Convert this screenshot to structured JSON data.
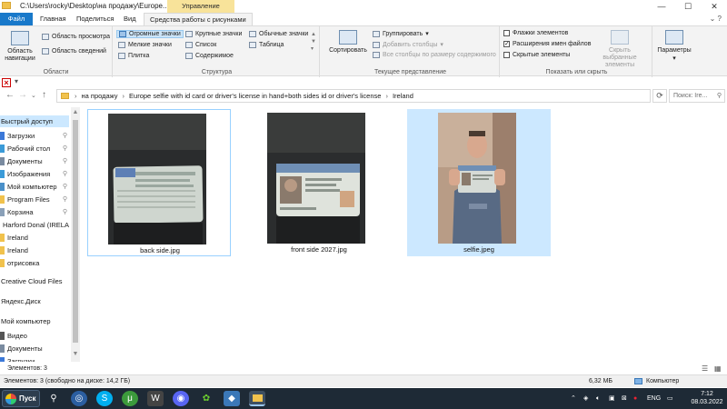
{
  "window": {
    "title": "C:\\Users\\rocky\\Desktop\\на продажу\\Europe...",
    "context_tab": "Управление",
    "controls": {
      "minimize": "—",
      "maximize": "☐",
      "close": "✕"
    }
  },
  "tabs": [
    "Файл",
    "Главная",
    "Поделиться",
    "Вид",
    "Средства работы с рисунками"
  ],
  "ribbon": {
    "panels": {
      "nav_pane": "Область навигации",
      "preview": "Область просмотра",
      "details": "Область сведений",
      "label": "Области"
    },
    "layout": {
      "items": [
        "Огромные значки",
        "Крупные значки",
        "Обычные значки",
        "Мелкие значки",
        "Список",
        "Таблица",
        "Плитка",
        "Содержимое"
      ],
      "label": "Структура"
    },
    "current_view": {
      "sort": "Сортировать",
      "group": "Группировать",
      "add_columns": "Добавить столбцы",
      "fit_columns": "Все столбцы по размеру содержимого",
      "label": "Текущее представление"
    },
    "show_hide": {
      "item_checkboxes": "Флажки элементов",
      "file_extensions": "Расширения имен файлов",
      "hidden_items": "Скрытые элементы",
      "hide_selected": "Скрыть выбранные элементы",
      "label": "Показать или скрыть"
    },
    "options": "Параметры"
  },
  "address": {
    "crumbs": [
      "на продажу",
      "Europe selfie with id card or driver's license in hand+both sides id or driver's license",
      "Ireland"
    ],
    "search_placeholder": "Поиск: Ire..."
  },
  "nav": [
    {
      "label": "Быстрый доступ",
      "head": true,
      "selected": true,
      "color": ""
    },
    {
      "label": "Загрузки",
      "pin": true,
      "color": "#3b78d8"
    },
    {
      "label": "Рабочий стол",
      "pin": true,
      "color": "#3b9bd8"
    },
    {
      "label": "Документы",
      "pin": true,
      "color": "#7a8ba0"
    },
    {
      "label": "Изображения",
      "pin": true,
      "color": "#3b9bd8"
    },
    {
      "label": "Мой компьютер",
      "pin": true,
      "color": "#4a90c9"
    },
    {
      "label": "Program Files",
      "pin": true,
      "color": "#f1c24d"
    },
    {
      "label": "Корзина",
      "pin": true,
      "color": "#8aa0b8"
    },
    {
      "label": "Harford Donal (IRELAN",
      "color": "#f1c24d"
    },
    {
      "label": "Ireland",
      "color": "#f1c24d"
    },
    {
      "label": "Ireland",
      "color": "#f1c24d"
    },
    {
      "label": "отрисовка",
      "color": "#f1c24d"
    },
    {
      "label": "Creative Cloud Files",
      "head": true,
      "color": ""
    },
    {
      "label": "Яндекс.Диск",
      "head": true,
      "color": ""
    },
    {
      "label": "Мой компьютер",
      "head": true,
      "color": ""
    },
    {
      "label": "Видео",
      "color": "#555"
    },
    {
      "label": "Документы",
      "color": "#7a8ba0"
    },
    {
      "label": "Загрузки",
      "color": "#3b78d8"
    }
  ],
  "files": [
    {
      "name": "back side.jpg",
      "state": "focused"
    },
    {
      "name": "front side 2027.jpg",
      "state": "normal"
    },
    {
      "name": "selfie.jpeg",
      "state": "selected"
    }
  ],
  "status": {
    "items": "Элементов: 3",
    "details_left": "Элементов: 3 (свободно на диске: 14,2 ГБ)",
    "size": "6,32 МБ",
    "location": "Компьютер"
  },
  "taskbar": {
    "start": "Пуск",
    "lang": "ENG",
    "time": "7:12",
    "date": "08.03.2022"
  }
}
